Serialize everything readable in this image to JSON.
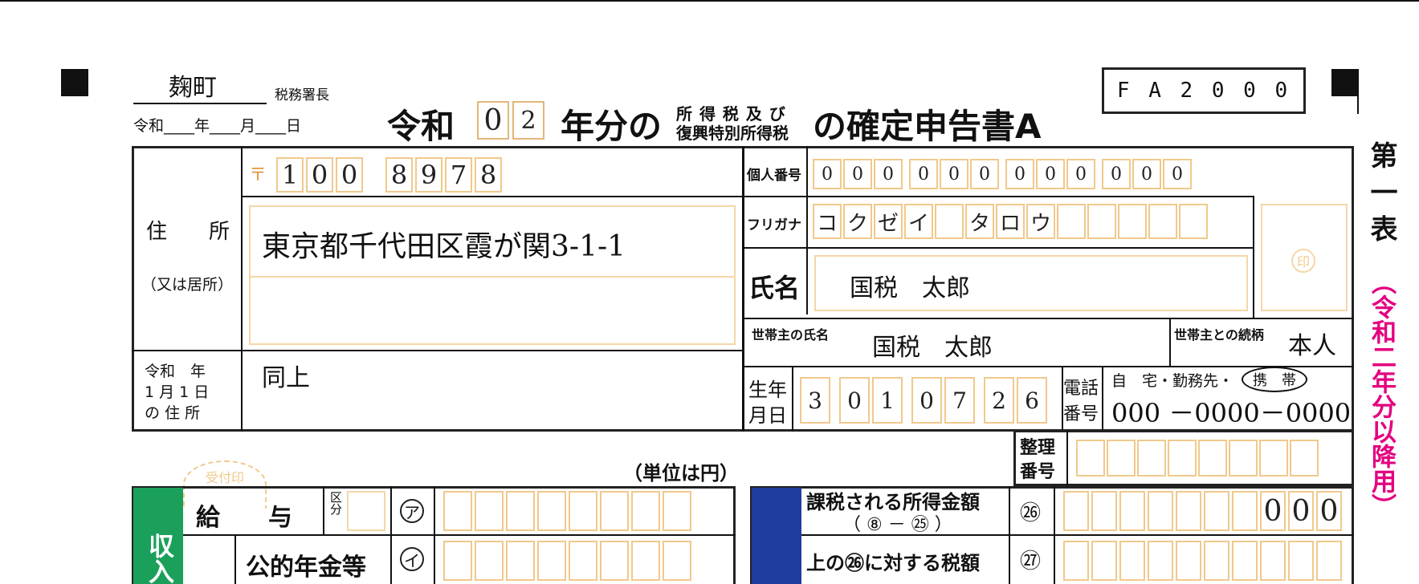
{
  "header": {
    "office": "麹町",
    "office_suffix": "税務署長",
    "date_line": "令和____年____月____日",
    "era": "令和",
    "year_digits": [
      "0",
      "2"
    ],
    "year_suffix": "年分の",
    "tax_small_1": "所 得 税 及 び",
    "tax_small_2": "復興特別所得税",
    "title_suffix": "の確定申告書A",
    "form_code": "F A 2 0 0 0",
    "side_title": "第 一 表",
    "side_note": "（令和二年分以降用）"
  },
  "address": {
    "postal_mark": "〒",
    "postal_digits": [
      "1",
      "0",
      "0",
      "8",
      "9",
      "7",
      "8"
    ],
    "label_main": "住　　所",
    "label_alt": "（又は居所）",
    "value": "東京都千代田区霞が関3-1-1",
    "jan1_label_1": "令和　年",
    "jan1_label_2": "1 月 1 日",
    "jan1_label_3": "の 住 所",
    "jan1_value": "同上"
  },
  "personal": {
    "mynumber_label": "個人番号",
    "mynumber_digits": [
      "0",
      "0",
      "0",
      "0",
      "0",
      "0",
      "0",
      "0",
      "0",
      "0",
      "0",
      "0"
    ],
    "furigana_label": "フリガナ",
    "furigana_chars": [
      "コ",
      "ク",
      "ゼ",
      "イ",
      "",
      "タ",
      "ロ",
      "ウ",
      "",
      "",
      "",
      "",
      ""
    ],
    "name_label": "氏名",
    "name_value": "国税　太郎",
    "seal_mark": "印",
    "householder_label": "世帯主の氏名",
    "householder_value": "国税　太郎",
    "relation_label": "世帯主との続柄",
    "relation_value": "本人",
    "birth_label_1": "生年",
    "birth_label_2": "月日",
    "birth_digits": [
      "3",
      "0",
      "1",
      "0",
      "7",
      "2",
      "6"
    ],
    "phone_label_1": "電話",
    "phone_label_2": "番号",
    "phone_types": "自　宅・勤務先・",
    "phone_type_selected": "携　帯",
    "phone_value": "000 －0000－0000"
  },
  "lower": {
    "receipt_stamp": "受付印",
    "unit_note": "（単位は円）",
    "seiri_label_1": "整理",
    "seiri_label_2": "番号",
    "income_section": "収入",
    "row1_label": "給　　与",
    "row1_kubun": "区分",
    "row1_code": "ア",
    "row2_label": "公的年金等",
    "row2_code": "イ",
    "tax1_label_1": "課税される所得金額",
    "tax1_label_2": "（ ⑧ － ㉕ ）",
    "tax1_code": "㉖",
    "tax1_value": [
      "",
      "",
      "",
      "",
      "",
      "",
      "",
      "0",
      "0",
      "0"
    ],
    "tax2_label": "上の㉖に対する税額",
    "tax2_code": "㉗"
  },
  "colors": {
    "accent_green": "#1aa05a",
    "accent_blue": "#1f3d9c",
    "accent_magenta": "#e4007f",
    "field_orange": "#f0c98c"
  }
}
